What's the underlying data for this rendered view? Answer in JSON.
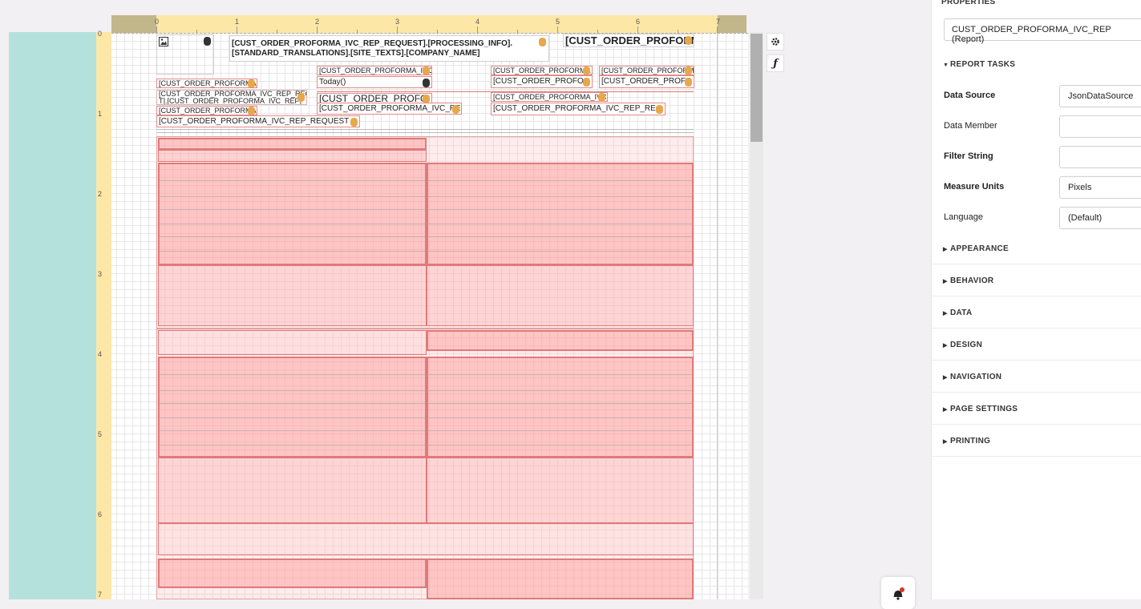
{
  "rulers": {
    "horizontal": [
      "0",
      "1",
      "2",
      "3",
      "4",
      "5",
      "6",
      "7"
    ],
    "vertical": [
      "0",
      "1",
      "2",
      "3",
      "4",
      "5",
      "6",
      "7"
    ]
  },
  "tools": {
    "settings_icon": "gear-icon",
    "expression_icon": "function-icon",
    "expression_glyph": "ƒ"
  },
  "controls": {
    "header_expr_line1": "[CUST_ORDER_PROFORMA_IVC_REP_REQUEST].[PROCESSING_INFO].",
    "header_expr_line2": "[STANDARD_TRANSLATIONS].[SITE_TEXTS].[COMPANY_NAME]",
    "top_right_big": "[CUST_ORDER_PROFORMA",
    "left_small_1": "[CUST_ORDER_PROFORMA_",
    "left_small_2a": "[CUST_ORDER_PROFORMA_IVC_REP_REQUE",
    "left_small_2b": "T].[CUST_ORDER_PROFORMA_IVC_REP]",
    "left_small_3": "[CUST_ORDER_PROFORMA_",
    "left_wide": "[CUST_ORDER_PROFORMA_IVC_REP_REQUEST",
    "mid_small_top": "[CUST_ORDER_PROFORMA_IVC_RE",
    "today": "Today()",
    "mid_big": "[CUST_ORDER_PROFO",
    "mid_field": "[CUST_ORDER_PROFORMA_IVC_RE",
    "r1_small": "[CUST_ORDER_PROFORMA_",
    "r1_field": "[CUST_ORDER_PROFO",
    "r2_small": "[CUST_ORDER_PROFORMA_",
    "r2_field": "[CUST_ORDER_PROFO",
    "r3_small": "[CUST_ORDER_PROFORMA_IVC_RE",
    "r3_field": "[CUST_ORDER_PROFORMA_IVC_REP_RE"
  },
  "panel": {
    "title": "PROPERTIES",
    "report_selector": "CUST_ORDER_PROFORMA_IVC_REP (Report)",
    "report_tasks": "REPORT TASKS",
    "props": [
      {
        "label": "Data Source",
        "value": "JsonDataSource",
        "bold": true
      },
      {
        "label": "Data Member",
        "value": "",
        "bold": false
      },
      {
        "label": "Filter String",
        "value": "",
        "bold": true
      },
      {
        "label": "Measure Units",
        "value": "Pixels",
        "bold": true
      },
      {
        "label": "Language",
        "value": "(Default)",
        "bold": false
      }
    ],
    "sections": [
      "APPEARANCE",
      "BEHAVIOR",
      "DATA",
      "DESIGN",
      "NAVIGATION",
      "PAGE SETTINGS",
      "PRINTING"
    ]
  },
  "notification": {
    "icon": "bell-icon",
    "has_badge": true
  },
  "colors": {
    "teal": "#b5e1dd",
    "ruler": "#fde7a6",
    "band": "#e07a7a",
    "db_icon": "#e8a84a"
  }
}
